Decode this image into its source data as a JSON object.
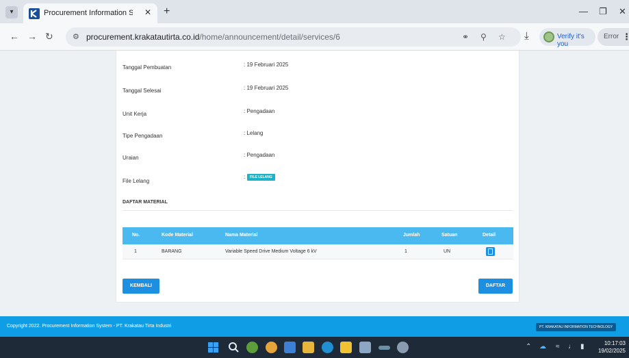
{
  "browser": {
    "tab_title": "Procurement Information Syste",
    "url_host": "procurement.krakatautirta.co.id",
    "url_path": "/home/announcement/detail/services/6",
    "verify_label": "Verify it's you",
    "error_label": "Error"
  },
  "details": {
    "rows": [
      {
        "label": "Tanggal Pembuatan",
        "value": ": 19 Februari 2025"
      },
      {
        "label": "Tanggal Selesai",
        "value": ": 19 Februari 2025"
      },
      {
        "label": "Unit Kerja",
        "value": ": Pengadaan"
      },
      {
        "label": "Tipe Pengadaan",
        "value": ": Lelang"
      },
      {
        "label": "Uraian",
        "value": ": Pengadaan"
      }
    ],
    "file_label": "File Lelang",
    "file_button": "FILE LELANG"
  },
  "materials": {
    "section_title": "DAFTAR MATERIAL",
    "columns": [
      "No.",
      "Kode Material",
      "Nama Material",
      "Jumlah",
      "Satuan",
      "Detail"
    ],
    "rows": [
      {
        "no": "1",
        "kode": "BARANG",
        "nama": "Variable Speed Drive Medium Voltage 6 kV",
        "jumlah": "1",
        "satuan": "UN"
      }
    ]
  },
  "actions": {
    "back_label": "KEMBALI",
    "register_label": "DAFTAR"
  },
  "footer": {
    "copyright": "Copyright 2022. Procurement Information System - PT. Krakatau Tirta Industri",
    "badge": "PT. KRAKATAU INFORMATION TECHNOLOGY"
  },
  "taskbar": {
    "time": "10:17:03",
    "date": "19/02/2025"
  },
  "colors": {
    "accent": "#1d8fe1",
    "table_header": "#4ab9f0",
    "footer": "#0f9de6",
    "file_button": "#19b4c7"
  }
}
